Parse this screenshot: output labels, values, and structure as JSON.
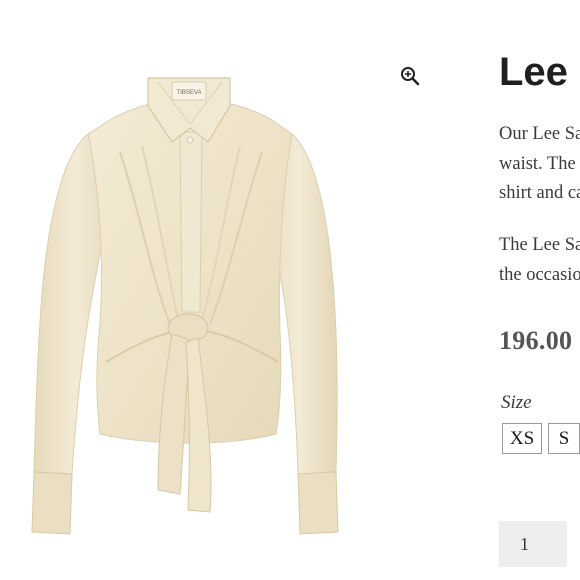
{
  "product": {
    "title": "Lee Satin Shirt",
    "description_1": [
      "Our Lee Satin shirt features a tie at the front",
      "waist. The silky fabric makes it a versatile",
      "shirt and can be dressed up or down."
    ],
    "description_2": [
      "The Lee Satin shirt is perfect for any time of",
      "the occasion."
    ],
    "price": "196.00",
    "image_alt": "Cream satin long-sleeve tie-front shirt",
    "label_text": "TIBSEVA"
  },
  "size": {
    "label": "Size",
    "options": [
      "XS",
      "S"
    ]
  },
  "quantity": {
    "value": "1"
  },
  "icons": {
    "zoom": "zoom-in-icon"
  },
  "colors": {
    "fabric": "#efe6cd",
    "text": "#3a3a3a",
    "title": "#1f1f1f",
    "price": "#555555"
  }
}
